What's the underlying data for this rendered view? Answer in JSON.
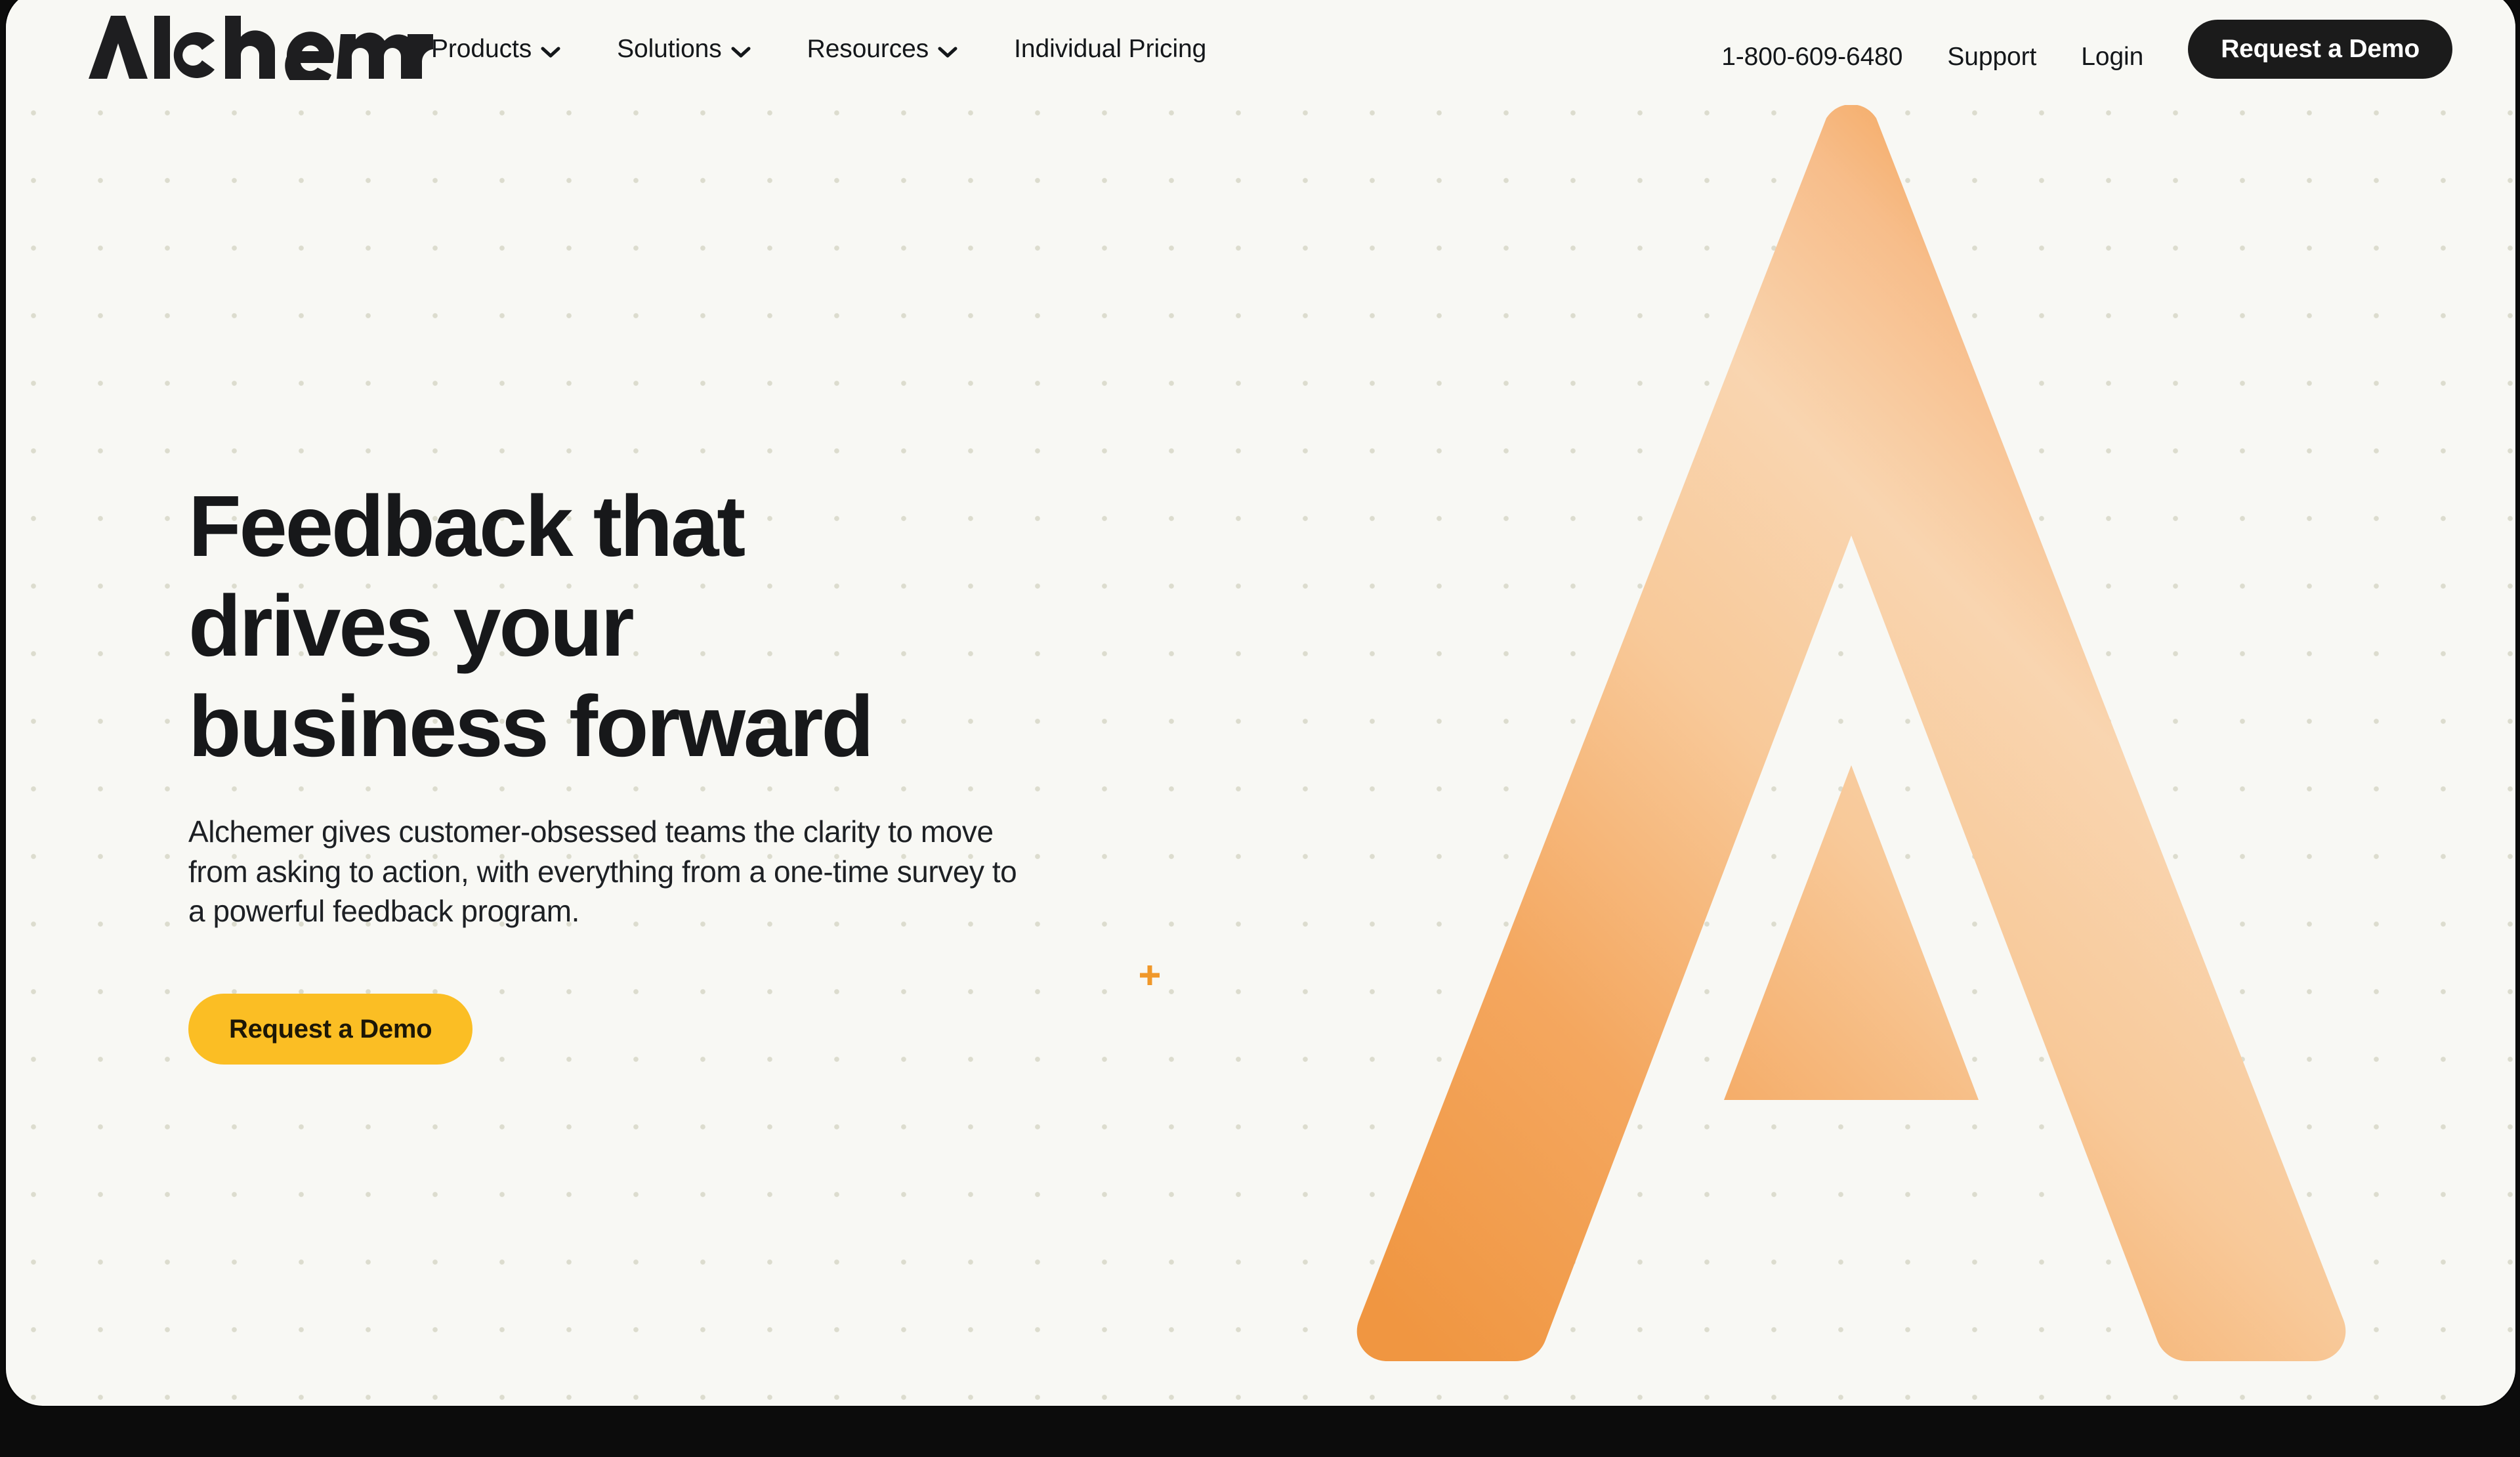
{
  "brand": {
    "name": "Alchemer",
    "logo_icon": "alchemer-wordmark"
  },
  "header": {
    "nav_items": [
      {
        "label": "Products",
        "has_dropdown": true,
        "icon": "chevron-down-icon"
      },
      {
        "label": "Solutions",
        "has_dropdown": true,
        "icon": "chevron-down-icon"
      },
      {
        "label": "Resources",
        "has_dropdown": true,
        "icon": "chevron-down-icon"
      },
      {
        "label": "Individual Pricing",
        "has_dropdown": false,
        "icon": ""
      }
    ],
    "utility_links": [
      {
        "label": "1-800-609-6480"
      },
      {
        "label": "Support"
      },
      {
        "label": "Login"
      }
    ],
    "cta_label": "Request a Demo"
  },
  "hero": {
    "headline": "Feedback that\ndrives your\nbusiness forward",
    "subcopy": "Alchemer gives customer-obsessed teams the clarity to move from asking to action, with everything from a one-time survey to a powerful feedback program.",
    "cta_label": "Request a Demo",
    "brandmark_icon": "alchemer-a-mark",
    "accent_icon": "plus-icon"
  },
  "colors": {
    "page_background": "#f8f8f4",
    "frame": "#0c0c0c",
    "text_primary": "#17181a",
    "header_cta_background": "#1b1b1b",
    "header_cta_text": "#ffffff",
    "hero_cta_background": "#fbbe24",
    "hero_cta_text": "#1d1706",
    "dot_grid": "#dcdcce",
    "brandmark_orange_dark": "#f29b4a",
    "brandmark_orange_light": "#f9d2ab",
    "accent_plus": "#f0982a"
  }
}
